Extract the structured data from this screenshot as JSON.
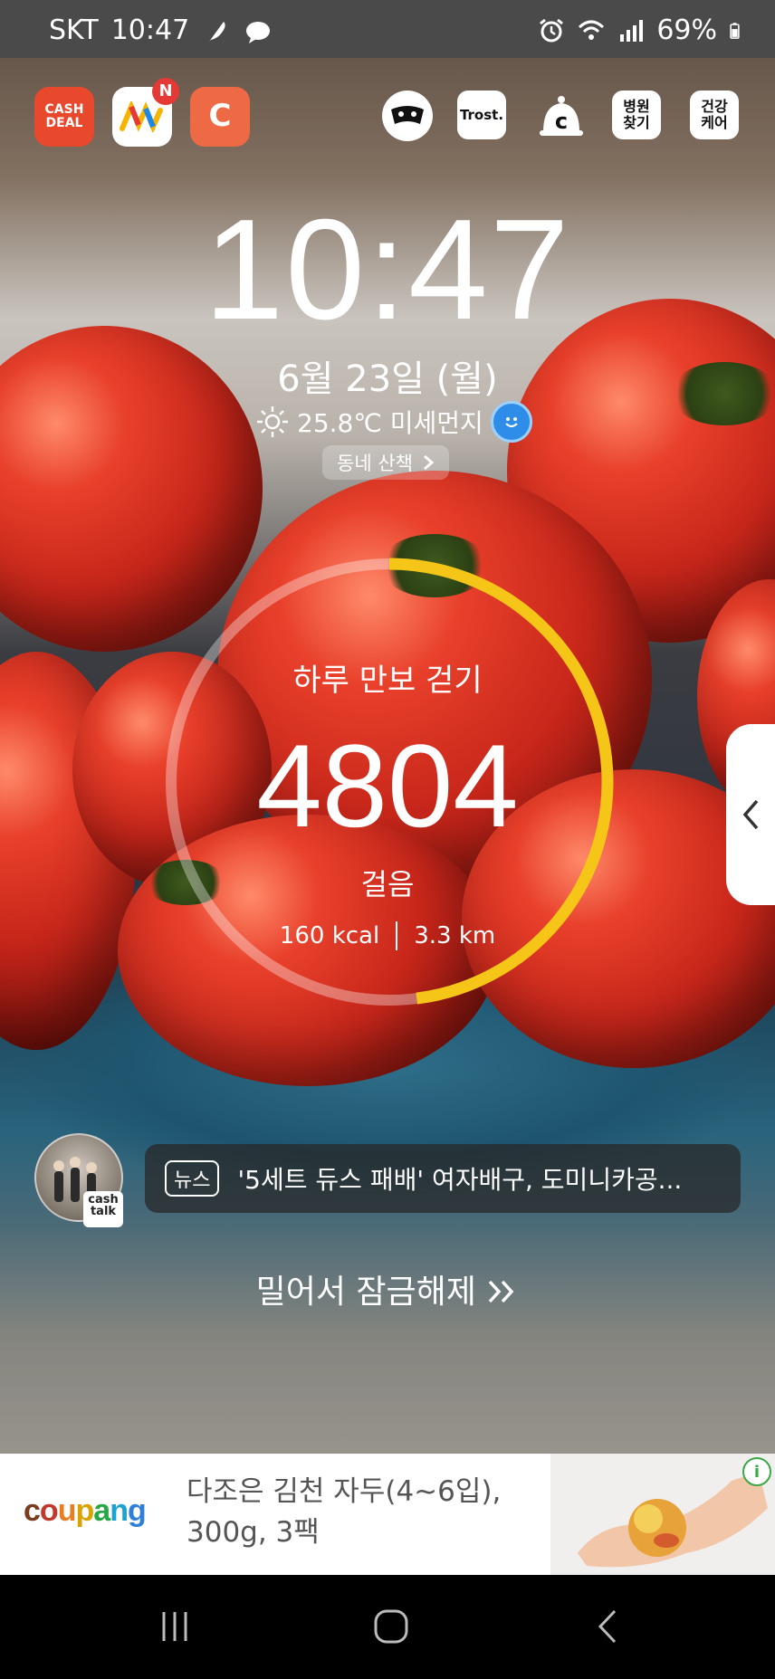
{
  "status_bar": {
    "carrier": "SKT",
    "time": "10:47",
    "battery": "69%",
    "icons": [
      "feather-icon",
      "cloud-chat-icon",
      "alarm-icon",
      "wifi-icon",
      "signal-icon",
      "battery-icon"
    ]
  },
  "shortcuts": {
    "cash_deal": "CASH\nDEAL",
    "yanolja_badge": "N",
    "cashwalk": "C",
    "trost": "Trost.",
    "hospital": "병원\n찾기",
    "health": "건강\n케어"
  },
  "lock": {
    "time": "10:47",
    "date": "6월 23일 (월)",
    "weather": "25.8℃ 미세먼지",
    "walk_chip": "동네 산책"
  },
  "pedometer": {
    "title": "하루 만보 걷기",
    "steps": "4804",
    "unit": "걸음",
    "kcal": "160 kcal",
    "distance": "3.3 km",
    "progress": 0.48
  },
  "news": {
    "tag": "뉴스",
    "headline": "'5세트 듀스 패배' 여자배구, 도미니카공...",
    "badge": "cash\ntalk"
  },
  "unlock_text": "밀어서 잠금해제",
  "ad": {
    "brand": "coupang",
    "line1": "다조은 김천 자두(4~6입),",
    "line2": "300g, 3팩",
    "info": "i"
  },
  "colors": {
    "ring_progress": "#F5C518",
    "coupang_red": "#C0392B",
    "status_bar": "#4A4A4A"
  }
}
